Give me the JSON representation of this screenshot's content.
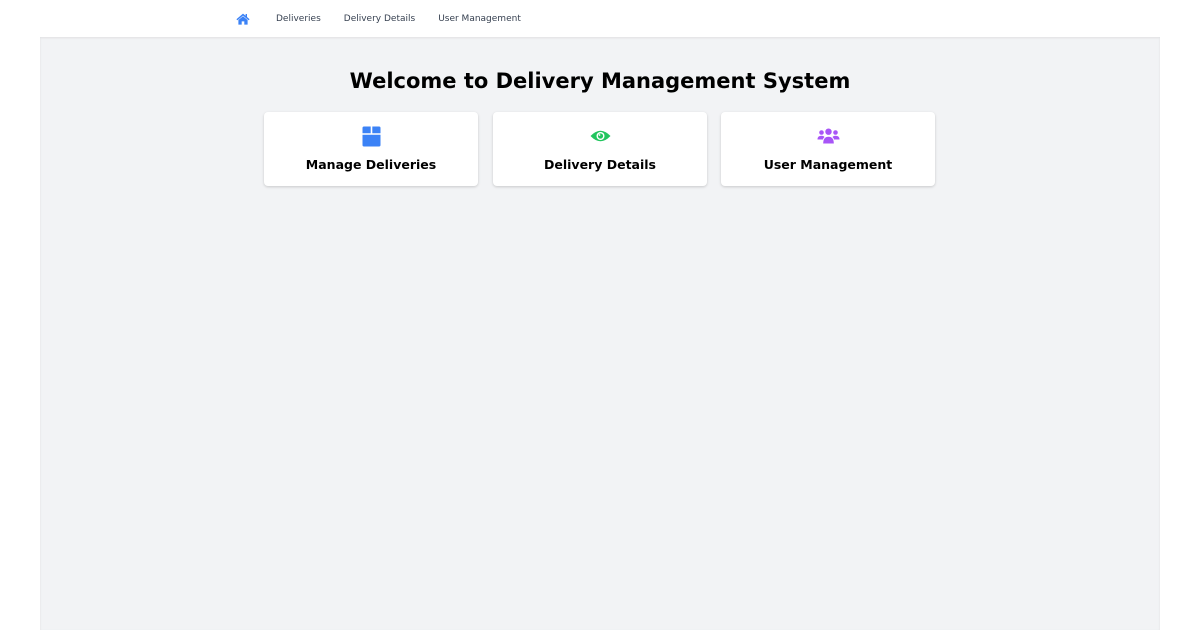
{
  "navbar": {
    "home_icon": "home-icon",
    "links": [
      {
        "label": "Deliveries"
      },
      {
        "label": "Delivery Details"
      },
      {
        "label": "User Management"
      }
    ]
  },
  "main": {
    "title": "Welcome to Delivery Management System",
    "cards": [
      {
        "label": "Manage Deliveries",
        "icon": "box-icon",
        "color": "#3b82f6"
      },
      {
        "label": "Delivery Details",
        "icon": "eye-icon",
        "color": "#22c55e"
      },
      {
        "label": "User Management",
        "icon": "users-icon",
        "color": "#a855f7"
      }
    ]
  },
  "colors": {
    "accent_home": "#3b82f6",
    "page_background": "#f2f3f5"
  }
}
